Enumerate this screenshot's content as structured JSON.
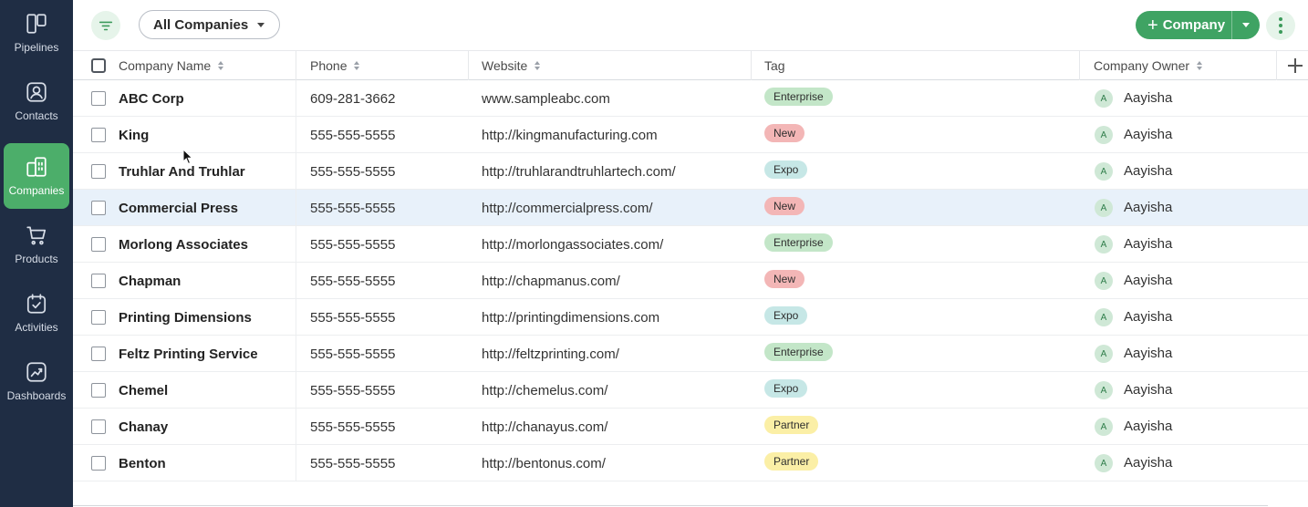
{
  "sidebar": {
    "items": [
      {
        "label": "Pipelines",
        "icon": "pipelines-icon",
        "active": false
      },
      {
        "label": "Contacts",
        "icon": "contacts-icon",
        "active": false
      },
      {
        "label": "Companies",
        "icon": "companies-icon",
        "active": true
      },
      {
        "label": "Products",
        "icon": "cart-icon",
        "active": false
      },
      {
        "label": "Activities",
        "icon": "calendar-check-icon",
        "active": false
      },
      {
        "label": "Dashboards",
        "icon": "dashboard-chart-icon",
        "active": false
      }
    ]
  },
  "toolbar": {
    "view_selected": "All Companies",
    "add_label": "Company"
  },
  "table": {
    "columns": [
      "Company Name",
      "Phone",
      "Website",
      "Tag",
      "Company Owner"
    ],
    "rows": [
      {
        "name": "ABC Corp",
        "phone": "609-281-3662",
        "website": "www.sampleabc.com",
        "tag": "Enterprise",
        "owner_initial": "A",
        "owner": "Aayisha"
      },
      {
        "name": "King",
        "phone": "555-555-5555",
        "website": "http://kingmanufacturing.com",
        "tag": "New",
        "owner_initial": "A",
        "owner": "Aayisha"
      },
      {
        "name": "Truhlar And Truhlar",
        "phone": "555-555-5555",
        "website": "http://truhlarandtruhlartech.com/",
        "tag": "Expo",
        "owner_initial": "A",
        "owner": "Aayisha"
      },
      {
        "name": "Commercial Press",
        "phone": "555-555-5555",
        "website": "http://commercialpress.com/",
        "tag": "New",
        "owner_initial": "A",
        "owner": "Aayisha"
      },
      {
        "name": "Morlong Associates",
        "phone": "555-555-5555",
        "website": "http://morlongassociates.com/",
        "tag": "Enterprise",
        "owner_initial": "A",
        "owner": "Aayisha"
      },
      {
        "name": "Chapman",
        "phone": "555-555-5555",
        "website": "http://chapmanus.com/",
        "tag": "New",
        "owner_initial": "A",
        "owner": "Aayisha"
      },
      {
        "name": "Printing Dimensions",
        "phone": "555-555-5555",
        "website": "http://printingdimensions.com",
        "tag": "Expo",
        "owner_initial": "A",
        "owner": "Aayisha"
      },
      {
        "name": "Feltz Printing Service",
        "phone": "555-555-5555",
        "website": "http://feltzprinting.com/",
        "tag": "Enterprise",
        "owner_initial": "A",
        "owner": "Aayisha"
      },
      {
        "name": "Chemel",
        "phone": "555-555-5555",
        "website": "http://chemelus.com/",
        "tag": "Expo",
        "owner_initial": "A",
        "owner": "Aayisha"
      },
      {
        "name": "Chanay",
        "phone": "555-555-5555",
        "website": "http://chanayus.com/",
        "tag": "Partner",
        "owner_initial": "A",
        "owner": "Aayisha"
      },
      {
        "name": "Benton",
        "phone": "555-555-5555",
        "website": "http://bentonus.com/",
        "tag": "Partner",
        "owner_initial": "A",
        "owner": "Aayisha"
      }
    ]
  },
  "tag_colors": {
    "Enterprise": "#c3e6c8",
    "New": "#f3b6b6",
    "Expo": "#c6e7e6",
    "Partner": "#fbefa6"
  },
  "colors": {
    "sidebar_bg": "#1f2d44",
    "accent": "#3fa363",
    "row_highlight": "#e8f1fa"
  }
}
